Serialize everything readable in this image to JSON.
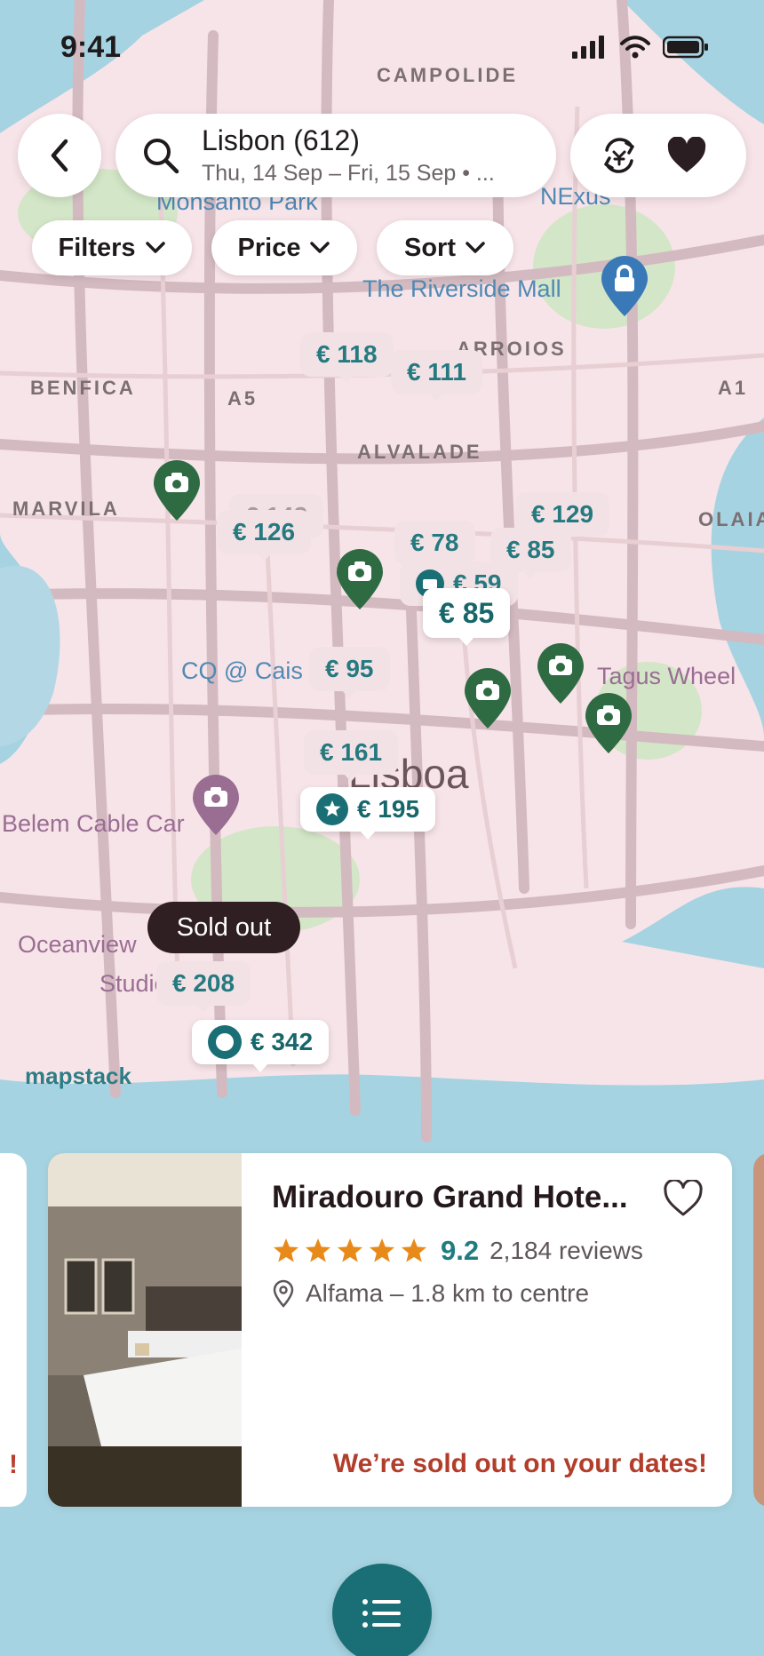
{
  "status_bar": {
    "time": "9:41"
  },
  "search": {
    "title": "Lisbon (612)",
    "subtitle": "Thu, 14 Sep – Fri, 15 Sep • ..."
  },
  "filters": {
    "filters_label": "Filters",
    "price_label": "Price",
    "sort_label": "Sort"
  },
  "map": {
    "districts": [
      "CAMPOLIDE",
      "BENFICA",
      "A5",
      "ARROIOS",
      "A1",
      "ALVALADE",
      "MARVILA",
      "OLAIA"
    ],
    "pois": {
      "monsanto": "Monsanto Park",
      "nexus": "NExus",
      "riverside": "The Riverside Mall",
      "cq": "CQ @ Cais d",
      "tagus": "Tagus Wheel",
      "belem": "Belem Cable Car",
      "oceanview": "Oceanview",
      "studio": "Studio",
      "city": "Lisboa"
    },
    "price_pins": {
      "p118": "€ 118",
      "p111": "€ 111",
      "p142": "€ 142",
      "p126": "€ 126",
      "p129": "€ 129",
      "p78": "€ 78",
      "p85a": "€ 85",
      "p59": "€ 59",
      "p85b": "€ 85",
      "p95": "€ 95",
      "p161": "€ 161",
      "p195": "€ 195",
      "p208": "€ 208",
      "p342": "€ 342"
    },
    "sold_out_tag": "Sold out",
    "attribution": "mapstack"
  },
  "hotel_card": {
    "name": "Miradouro Grand Hote...",
    "rating": 5,
    "score": "9.2",
    "reviews": "2,184 reviews",
    "location": "Alfama – 1.8 km to centre",
    "sold_out_message": "We’re sold out on your dates!"
  },
  "prev_card_mark": "!",
  "colors": {
    "map_land": "#f7e4e8",
    "water": "#a6d3e1",
    "park": "#cfe6c3",
    "teal": "#196f75",
    "marker_green": "#2e6b42",
    "marker_blue": "#3a79b8",
    "marker_purple": "#9a6d93",
    "sold_out_red": "#b33d2b",
    "star": "#e88a1a"
  },
  "icons": [
    "back-chevron-icon",
    "search-icon",
    "currency-exchange-icon",
    "heart-icon",
    "chevron-down-icon",
    "camera-icon",
    "lock-icon",
    "star-icon",
    "location-pin-icon",
    "list-icon"
  ]
}
